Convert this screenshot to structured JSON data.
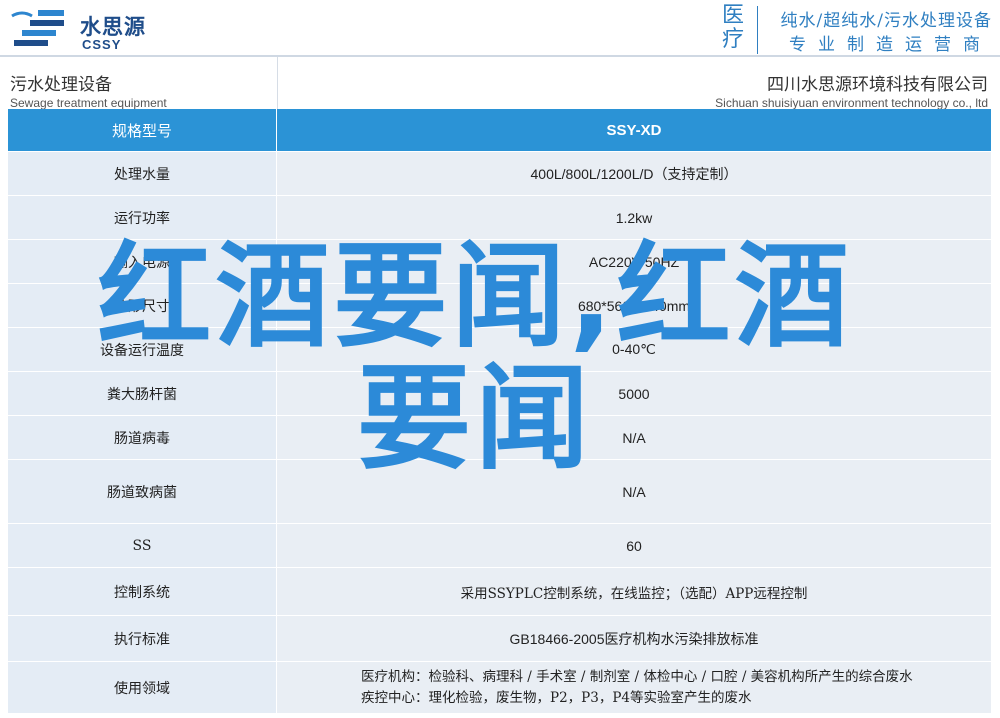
{
  "brand": {
    "name_cn": "水思源",
    "name_en": "CSSY",
    "logo": "water-wave-logo"
  },
  "slogan": {
    "big": "医疗",
    "line1": "纯水/超纯水/污水处理设备",
    "line2": "专业制造运营商"
  },
  "left_header": {
    "cn": "污水处理设备",
    "en": "Sewage treatment equipment"
  },
  "right_header": {
    "cn": "四川水思源环境科技有限公司",
    "en": "Sichuan shuisiyuan environment technology co., ltd"
  },
  "table": {
    "head": {
      "key": "规格型号",
      "val": "SSY-XD"
    },
    "rows": [
      {
        "key": "处理水量",
        "val": "400L/800L/1200L/D（支持定制）"
      },
      {
        "key": "运行功率",
        "val": "1.2kw"
      },
      {
        "key": "输入电源",
        "val": "AC220V/50HZ"
      },
      {
        "key": "外形尺寸",
        "val": "680*560*1440mm"
      },
      {
        "key": "设备运行温度",
        "val": "0-40℃"
      },
      {
        "key": "粪大肠杆菌",
        "val": "5000"
      },
      {
        "key": "肠道病毒",
        "val": "N/A"
      },
      {
        "key": "肠道致病菌",
        "val": "N/A"
      },
      {
        "key": "SS",
        "val": "60"
      },
      {
        "key": "控制系统",
        "val": "采用SSYPLC控制系统，在线监控；（选配）APP远程控制"
      },
      {
        "key": "执行标准",
        "val": "GB18466-2005医疗机构水污染排放标准"
      },
      {
        "key": "使用领域",
        "val_line1": "医疗机构：检验科、病理科 / 手术室 / 制剂室 / 体检中心 / 口腔 / 美容机构所产生的综合废水",
        "val_line2": "疾控中心：理化检验，废生物，P2，P3，P4等实验室产生的废水"
      }
    ]
  },
  "overlay": {
    "line1": "红酒要闻,红酒",
    "line2": "要闻"
  },
  "colors": {
    "header_blue": "#2b93d6",
    "overlay_blue": "#2c8ad8",
    "row_bg": "#e4ecf5",
    "brand_blue": "#1f4d8a"
  }
}
